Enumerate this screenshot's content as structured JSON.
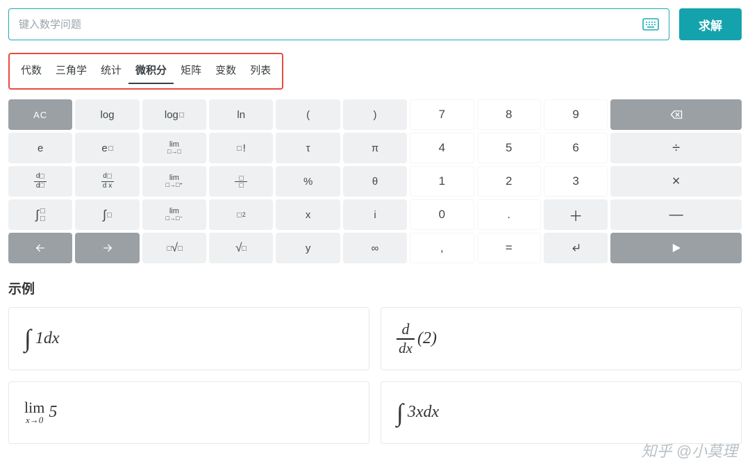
{
  "search": {
    "placeholder": "键入数学问题",
    "solve_label": "求解"
  },
  "tabs": {
    "items": [
      {
        "label": "代数",
        "active": false
      },
      {
        "label": "三角学",
        "active": false
      },
      {
        "label": "统计",
        "active": false
      },
      {
        "label": "微积分",
        "active": true
      },
      {
        "label": "矩阵",
        "active": false
      },
      {
        "label": "变数",
        "active": false
      },
      {
        "label": "列表",
        "active": false
      }
    ]
  },
  "keypad": {
    "row0": {
      "ac": "AC",
      "log": "log",
      "logbase": "log□",
      "ln": "ln",
      "lparen": "(",
      "rparen": ")",
      "n7": "7",
      "n8": "8",
      "n9": "9",
      "backspace": "⌫"
    },
    "row1": {
      "e": "e",
      "epow": "e□",
      "lim": "lim",
      "lim_sub": "□→□",
      "fact": "□!",
      "tau": "τ",
      "pi": "π",
      "n4": "4",
      "n5": "5",
      "n6": "6",
      "divide": "÷"
    },
    "row2": {
      "ddn_num": "d□",
      "ddn_den": "d□",
      "ddx_num": "d□",
      "ddx_den": "d x",
      "limr": "lim",
      "limr_sub": "□→□⁺",
      "frac_box": "□/□",
      "percent": "%",
      "theta": "θ",
      "n1": "1",
      "n2": "2",
      "n3": "3",
      "times": "×"
    },
    "row3": {
      "defint_sym": "∫",
      "defint_bounds": "□□",
      "indefint_sym": "∫",
      "indefint_var": "□",
      "liml": "lim",
      "liml_sub": "□→□⁻",
      "square": "□²",
      "x": "x",
      "ivar": "i",
      "n0": "0",
      "dot": ".",
      "plus": "＋",
      "minus": "—"
    },
    "row4": {
      "nroot": "ⁿ√□",
      "sqrt": "√□",
      "y": "y",
      "inf": "∞",
      "comma": ",",
      "equals": "=",
      "enter": "↵",
      "submit": "▷"
    }
  },
  "examples": {
    "heading": "示例",
    "cards": {
      "c0": {
        "int_sign": "∫",
        "body": "1dx"
      },
      "c1": {
        "frac_num": "d",
        "frac_den": "dx",
        "body": "(2)"
      },
      "c2": {
        "lim_top": "lim",
        "lim_sub": "x→0",
        "body": " 5"
      },
      "c3": {
        "int_sign": "∫",
        "body": "3xdx"
      }
    }
  },
  "watermark": "知乎 @小莫理"
}
